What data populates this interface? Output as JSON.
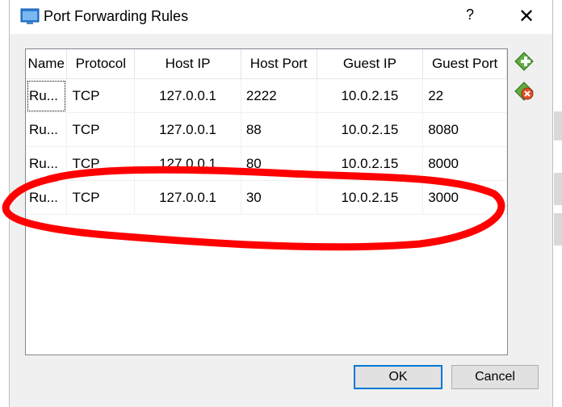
{
  "window": {
    "title": "Port Forwarding Rules",
    "help_label": "?",
    "close_label": "✕"
  },
  "table": {
    "columns": [
      "Name",
      "Protocol",
      "Host IP",
      "Host Port",
      "Guest IP",
      "Guest Port"
    ],
    "rows": [
      {
        "name": "Ru...",
        "protocol": "TCP",
        "host_ip": "127.0.0.1",
        "host_port": "2222",
        "guest_ip": "10.0.2.15",
        "guest_port": "22"
      },
      {
        "name": "Ru...",
        "protocol": "TCP",
        "host_ip": "127.0.0.1",
        "host_port": "88",
        "guest_ip": "10.0.2.15",
        "guest_port": "8080"
      },
      {
        "name": "Ru...",
        "protocol": "TCP",
        "host_ip": "127.0.0.1",
        "host_port": "80",
        "guest_ip": "10.0.2.15",
        "guest_port": "8000"
      },
      {
        "name": "Ru...",
        "protocol": "TCP",
        "host_ip": "127.0.0.1",
        "host_port": "30",
        "guest_ip": "10.0.2.15",
        "guest_port": "3000"
      }
    ]
  },
  "side_actions": {
    "add_icon": "add-rule-icon",
    "remove_icon": "remove-rule-icon"
  },
  "buttons": {
    "ok": "OK",
    "cancel": "Cancel"
  },
  "colors": {
    "accent": "#0078d7",
    "annotation": "#ff0000",
    "add_green": "#3c9a2e",
    "remove_red": "#e0502a"
  }
}
